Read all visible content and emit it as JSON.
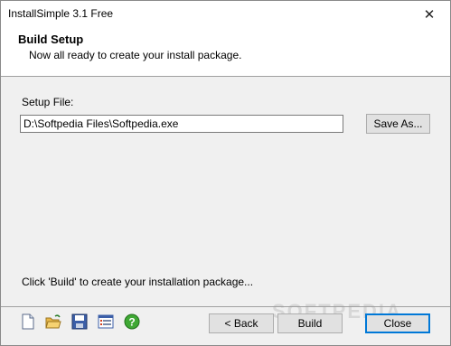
{
  "window": {
    "title": "InstallSimple 3.1 Free",
    "close_glyph": "✕"
  },
  "header": {
    "title": "Build Setup",
    "subtitle": "Now all ready to create your install package."
  },
  "form": {
    "setup_file_label": "Setup File:",
    "setup_file_value": "D:\\Softpedia Files\\Softpedia.exe",
    "save_as_label": "Save As..."
  },
  "status": "Click 'Build' to create your installation package...",
  "toolbar": {
    "icons": [
      "new-file-icon",
      "open-folder-icon",
      "save-disk-icon",
      "settings-list-icon",
      "help-icon"
    ]
  },
  "buttons": {
    "back_label": "< Back",
    "build_label": "Build",
    "close_label": "Close"
  },
  "watermark": "SOFTPEDIA",
  "colors": {
    "accent": "#0078d7",
    "dialog_bg": "#f0f0f0",
    "header_bg": "#ffffff"
  }
}
